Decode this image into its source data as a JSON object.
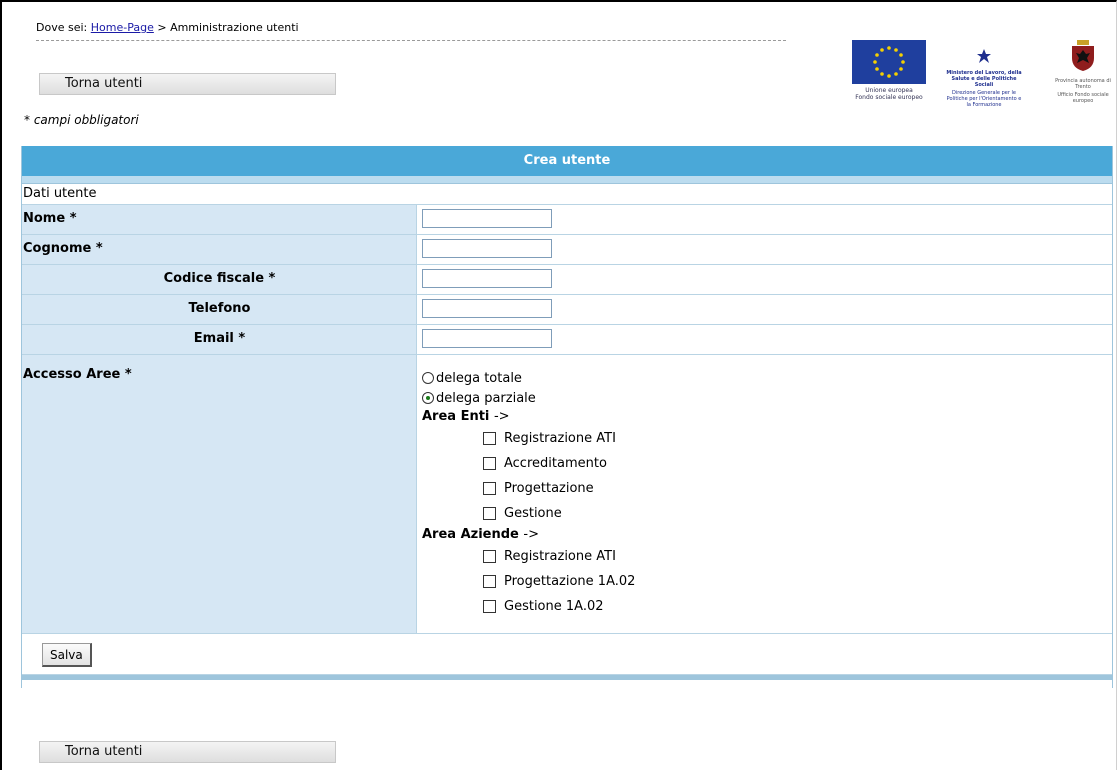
{
  "breadcrumb": {
    "prefix": "Dove sei:",
    "home_link": "Home-Page",
    "separator": ">",
    "current": "Amministrazione utenti"
  },
  "buttons": {
    "back_label": "Torna utenti",
    "save_label": "Salva"
  },
  "required_note": "* campi obbligatori",
  "logos": {
    "eu_caption_1": "Unione europea",
    "eu_caption_2": "Fondo sociale europeo",
    "ministry_text": "Ministero del Lavoro, della Salute e delle Politiche Sociali",
    "ministry_sub": "Direzione Generale per le Politiche per l'Orientamento e la Formazione",
    "province_text": "Provincia autonoma di Trento",
    "province_sub": "Ufficio Fondo sociale europeo"
  },
  "form": {
    "header": "Crea utente",
    "section": "Dati utente",
    "fields": [
      {
        "label": "Nome *",
        "value": ""
      },
      {
        "label": "Cognome *",
        "value": ""
      },
      {
        "label": "Codice fiscale *",
        "value": ""
      },
      {
        "label": "Telefono",
        "value": ""
      },
      {
        "label": "Email *",
        "value": ""
      }
    ],
    "access": {
      "label": "Accesso Aree *",
      "radio_total": "delega totale",
      "radio_partial": "delega parziale",
      "selected": "delega parziale",
      "area_enti": {
        "title": "Area Enti",
        "arrow": "->",
        "items": [
          "Registrazione ATI",
          "Accreditamento",
          "Progettazione",
          "Gestione"
        ]
      },
      "area_aziende": {
        "title": "Area Aziende",
        "arrow": "->",
        "items": [
          "Registrazione ATI",
          "Progettazione 1A.02",
          "Gestione 1A.02"
        ]
      }
    }
  },
  "colors": {
    "header_bg": "#4aa8d8",
    "label_bg": "#d6e7f4",
    "link": "#1a1aa6"
  }
}
